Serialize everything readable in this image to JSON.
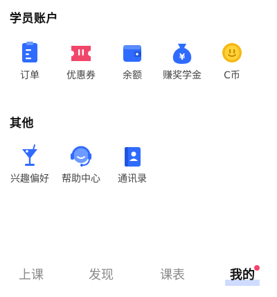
{
  "student_account": {
    "title": "学员账户",
    "items": [
      {
        "label": "订单",
        "icon": "order-icon"
      },
      {
        "label": "优惠券",
        "icon": "coupon-icon"
      },
      {
        "label": "余额",
        "icon": "wallet-icon"
      },
      {
        "label": "赚奖学金",
        "icon": "scholarship-bag-icon"
      },
      {
        "label": "C币",
        "icon": "c-coin-icon"
      }
    ]
  },
  "other": {
    "title": "其他",
    "items": [
      {
        "label": "兴趣偏好",
        "icon": "cocktail-glass-icon"
      },
      {
        "label": "帮助中心",
        "icon": "headset-icon"
      },
      {
        "label": "通讯录",
        "icon": "contacts-book-icon"
      }
    ]
  },
  "tabbar": {
    "tabs": [
      {
        "label": "上课",
        "active": false
      },
      {
        "label": "发现",
        "active": false
      },
      {
        "label": "课表",
        "active": false
      },
      {
        "label": "我的",
        "active": true
      }
    ]
  },
  "colors": {
    "blue": "#2f6bff",
    "pink": "#f2456a",
    "gold": "#f5b814",
    "active_underline": "#cfdcff"
  }
}
